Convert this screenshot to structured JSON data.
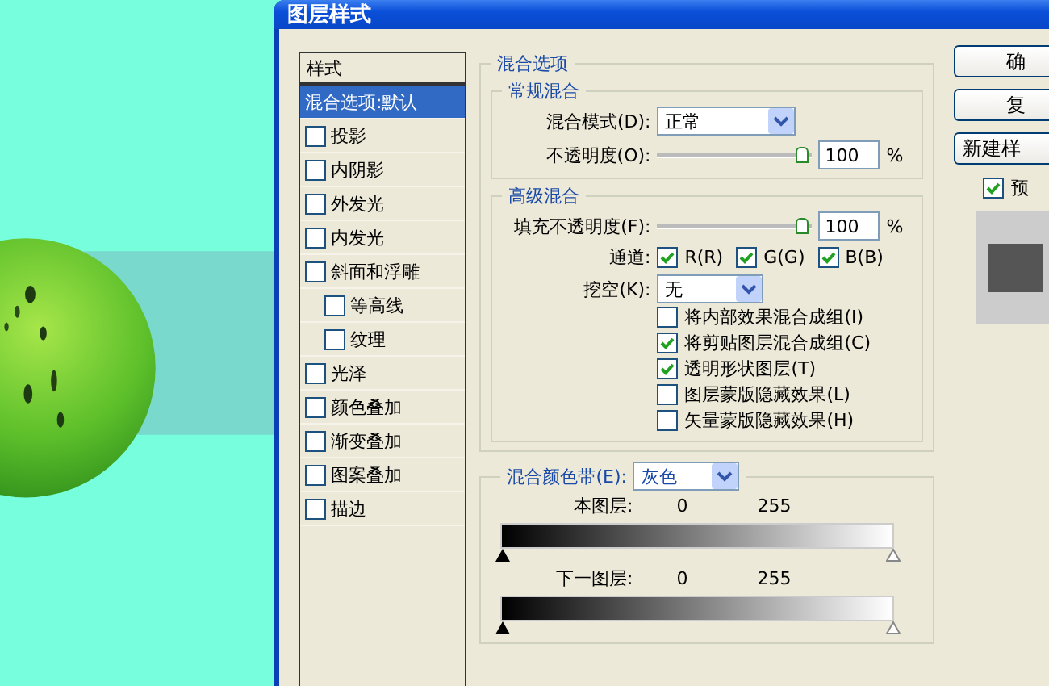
{
  "window": {
    "title": "图层样式"
  },
  "styles_panel": {
    "header": "样式",
    "items": [
      {
        "label": "混合选项:默认",
        "kind": "plain",
        "selected": true
      },
      {
        "label": "投影",
        "kind": "check",
        "checked": false,
        "selected": false
      },
      {
        "label": "内阴影",
        "kind": "check",
        "checked": false,
        "selected": false
      },
      {
        "label": "外发光",
        "kind": "check",
        "checked": false,
        "selected": false
      },
      {
        "label": "内发光",
        "kind": "check",
        "checked": false,
        "selected": false
      },
      {
        "label": "斜面和浮雕",
        "kind": "check",
        "checked": false,
        "selected": false,
        "children": [
          {
            "label": "等高线",
            "kind": "check",
            "checked": false,
            "selected": false
          },
          {
            "label": "纹理",
            "kind": "check",
            "checked": false,
            "selected": false
          }
        ]
      },
      {
        "label": "光泽",
        "kind": "check",
        "checked": false,
        "selected": false
      },
      {
        "label": "颜色叠加",
        "kind": "check",
        "checked": false,
        "selected": false
      },
      {
        "label": "渐变叠加",
        "kind": "check",
        "checked": false,
        "selected": false
      },
      {
        "label": "图案叠加",
        "kind": "check",
        "checked": false,
        "selected": false
      },
      {
        "label": "描边",
        "kind": "check",
        "checked": false,
        "selected": false
      }
    ]
  },
  "blending_options": {
    "title": "混合选项",
    "general": {
      "title": "常规混合",
      "mode": {
        "label": "混合模式(D):",
        "value": "正常"
      },
      "opacity": {
        "label": "不透明度(O):",
        "level": 1,
        "value": "100",
        "unit": "%"
      }
    },
    "advanced": {
      "title": "高级混合",
      "fill_opacity": {
        "label": "填充不透明度(F):",
        "level": 1,
        "value": "100",
        "unit": "%"
      },
      "channels": {
        "label": "通道:",
        "items": [
          {
            "label": "R(R)",
            "checked": true
          },
          {
            "label": "G(G)",
            "checked": true
          },
          {
            "label": "B(B)",
            "checked": true
          }
        ]
      },
      "knockout": {
        "label": "挖空(K):",
        "value": "无"
      },
      "options": [
        {
          "label": "将内部效果混合成组(I)",
          "checked": false
        },
        {
          "label": "将剪贴图层混合成组(C)",
          "checked": true
        },
        {
          "label": "透明形状图层(T)",
          "checked": true
        },
        {
          "label": "图层蒙版隐藏效果(L)",
          "checked": false
        },
        {
          "label": "矢量蒙版隐藏效果(H)",
          "checked": false
        }
      ]
    }
  },
  "blend_if": {
    "label": "混合颜色带(E):",
    "value": "灰色",
    "layers": [
      {
        "label": "本图层:",
        "low": "0",
        "high": "255"
      },
      {
        "label": "下一图层:",
        "low": "0",
        "high": "255"
      }
    ]
  },
  "buttons": [
    {
      "label": "确"
    },
    {
      "label": "复"
    },
    {
      "label": "新建样"
    }
  ],
  "preview": {
    "label": "预",
    "checked": true
  }
}
